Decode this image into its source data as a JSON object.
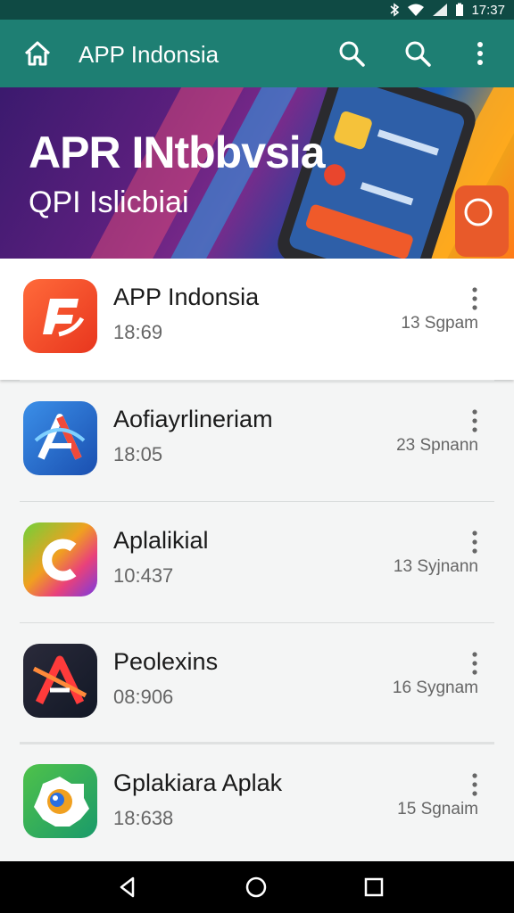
{
  "status_bar": {
    "time": "17:37"
  },
  "app_bar": {
    "title": "APP Indonsia",
    "home_icon": "home-icon",
    "actions": [
      "search-icon",
      "search-icon",
      "more-vert-icon"
    ]
  },
  "banner": {
    "headline": "APR INtbbvsia",
    "subline": "QPI Islicbiai"
  },
  "apps": [
    {
      "name": "APP Indonsia",
      "time": "18:69",
      "size": "13 Sgpam"
    },
    {
      "name": "Aofiayrlineriam",
      "time": "18:05",
      "size": "23 Spnann"
    },
    {
      "name": "Aplalikial",
      "time": "10:437",
      "size": "13 Syjnann"
    },
    {
      "name": "Peolexins",
      "time": "08:906",
      "size": "16 Sygnam"
    },
    {
      "name": "Gplakiara Aplak",
      "time": "18:638",
      "size": "15 Sgnaim"
    }
  ],
  "colors": {
    "status_bar": "#0f4a44",
    "app_bar": "#1e7f73",
    "nav_bar": "#000000"
  },
  "nav_bar": [
    "back-icon",
    "home-circle-icon",
    "recents-icon"
  ]
}
